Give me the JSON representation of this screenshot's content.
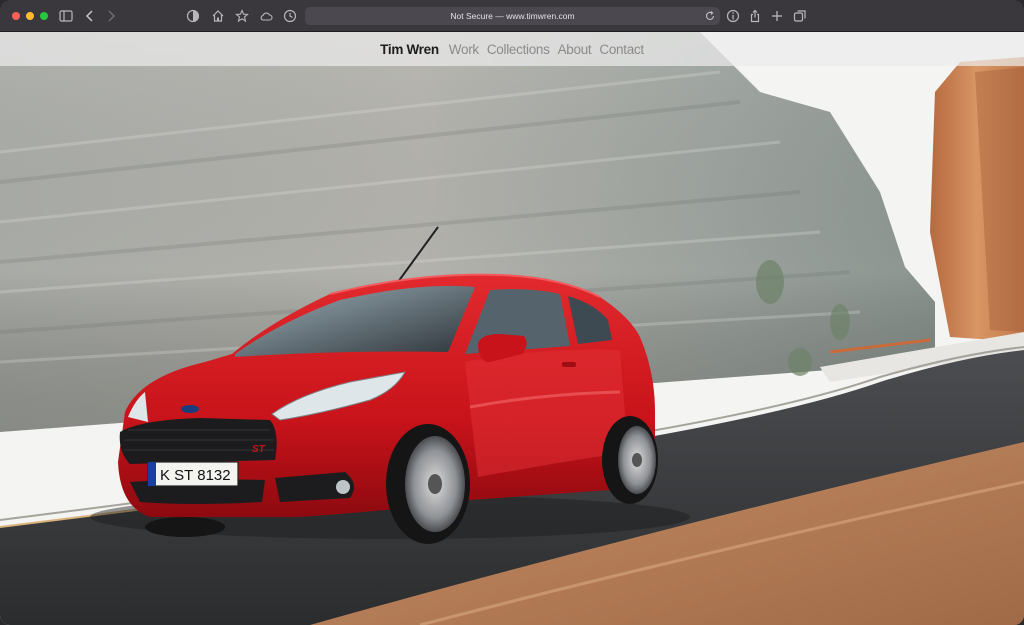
{
  "browser": {
    "url_text": "Not Secure — www.timwren.com",
    "traffic_colors": [
      "#ff5f57",
      "#febc2e",
      "#28c840"
    ],
    "icons": [
      "sidebar-icon",
      "back-icon",
      "forward-icon",
      "shield-icon",
      "home-icon",
      "star-icon",
      "cloud-icon",
      "history-icon",
      "reload-icon",
      "info-icon",
      "share-icon",
      "new-tab-icon",
      "tabs-overview-icon"
    ]
  },
  "site": {
    "brand": "Tim Wren",
    "nav": [
      "Work",
      "Collections",
      "About",
      "Contact"
    ],
    "hero_plate": "K ST 8132",
    "hero_badge": "ST"
  }
}
